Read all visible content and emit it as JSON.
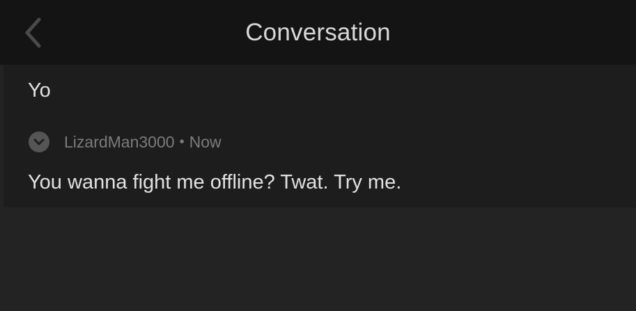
{
  "header": {
    "title": "Conversation",
    "back_icon": "chevron-left-icon"
  },
  "thread": {
    "previous_message": "Yo",
    "reply": {
      "author": "LizardMan3000",
      "separator": "•",
      "timestamp": "Now",
      "avatar_icon": "chevron-down-icon",
      "body": "You wanna fight me offline? Twat. Try me."
    }
  },
  "colors": {
    "nav_background": "#141414",
    "message_background": "#1d1d1d",
    "page_background": "#232323",
    "primary_text": "#e2e2e2",
    "secondary_text": "#7c7c7c"
  }
}
